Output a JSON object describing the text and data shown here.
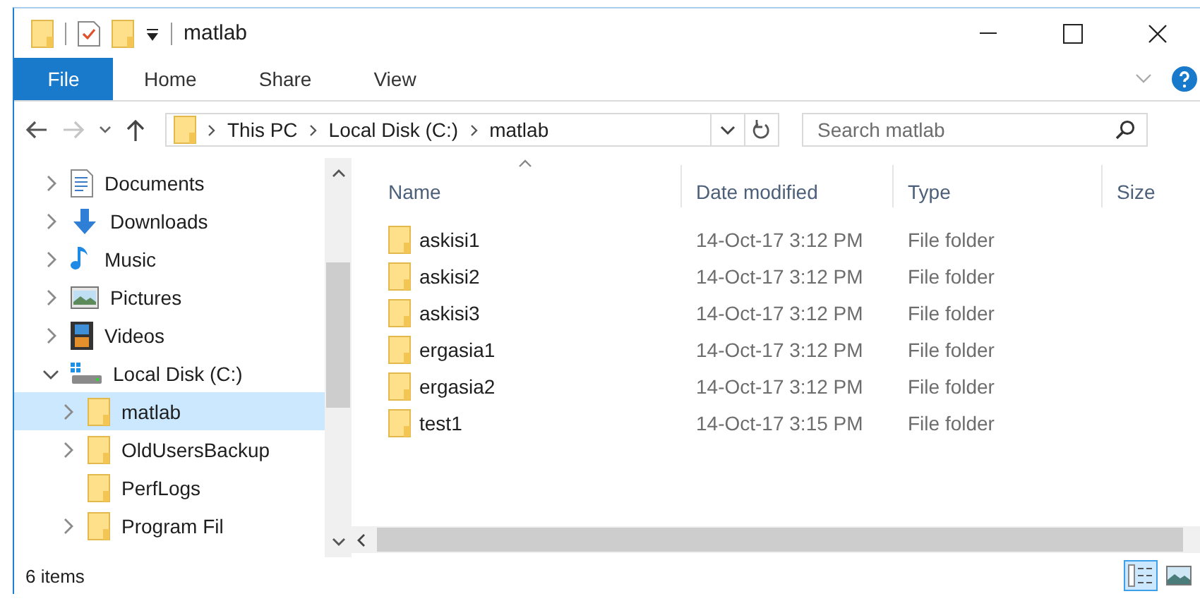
{
  "window": {
    "title": "matlab"
  },
  "ribbon_tabs": [
    {
      "label": "File",
      "selected": true
    },
    {
      "label": "Home",
      "selected": false
    },
    {
      "label": "Share",
      "selected": false
    },
    {
      "label": "View",
      "selected": false
    }
  ],
  "address": {
    "path": [
      "This PC",
      "Local Disk (C:)",
      "matlab"
    ]
  },
  "search": {
    "placeholder": "Search matlab"
  },
  "nav": {
    "items": [
      {
        "label": "Documents",
        "kind": "documents",
        "expandable": true,
        "expanded": false,
        "selected": false
      },
      {
        "label": "Downloads",
        "kind": "downloads",
        "expandable": true,
        "expanded": false,
        "selected": false
      },
      {
        "label": "Music",
        "kind": "music",
        "expandable": true,
        "expanded": false,
        "selected": false
      },
      {
        "label": "Pictures",
        "kind": "pictures",
        "expandable": true,
        "expanded": false,
        "selected": false
      },
      {
        "label": "Videos",
        "kind": "videos",
        "expandable": true,
        "expanded": false,
        "selected": false
      },
      {
        "label": "Local Disk (C:)",
        "kind": "drive",
        "expandable": true,
        "expanded": true,
        "selected": false,
        "children": [
          {
            "label": "matlab",
            "kind": "folder",
            "expandable": true,
            "expanded": false,
            "selected": true
          },
          {
            "label": "OldUsersBackup",
            "kind": "folder",
            "expandable": true,
            "expanded": false,
            "selected": false
          },
          {
            "label": "PerfLogs",
            "kind": "folder",
            "expandable": false,
            "selected": false
          },
          {
            "label": "Program Fil",
            "kind": "folder",
            "expandable": true,
            "expanded": false,
            "selected": false
          }
        ]
      }
    ]
  },
  "file_list": {
    "columns": [
      "Name",
      "Date modified",
      "Type",
      "Size"
    ],
    "rows": [
      {
        "name": "askisi1",
        "date_modified": "14-Oct-17 3:12 PM",
        "type": "File folder",
        "selected": false
      },
      {
        "name": "askisi2",
        "date_modified": "14-Oct-17 3:12 PM",
        "type": "File folder",
        "selected": false
      },
      {
        "name": "askisi3",
        "date_modified": "14-Oct-17 3:12 PM",
        "type": "File folder",
        "selected": false
      },
      {
        "name": "ergasia1",
        "date_modified": "14-Oct-17 3:12 PM",
        "type": "File folder",
        "selected": false
      },
      {
        "name": "ergasia2",
        "date_modified": "14-Oct-17 3:12 PM",
        "type": "File folder",
        "selected": false
      },
      {
        "name": "test1",
        "date_modified": "14-Oct-17 3:15 PM",
        "type": "File folder",
        "selected": false
      }
    ]
  },
  "status_bar": {
    "item_count": "6 items",
    "views": [
      {
        "kind": "details",
        "selected": true
      },
      {
        "kind": "large_icons",
        "selected": false
      }
    ]
  }
}
